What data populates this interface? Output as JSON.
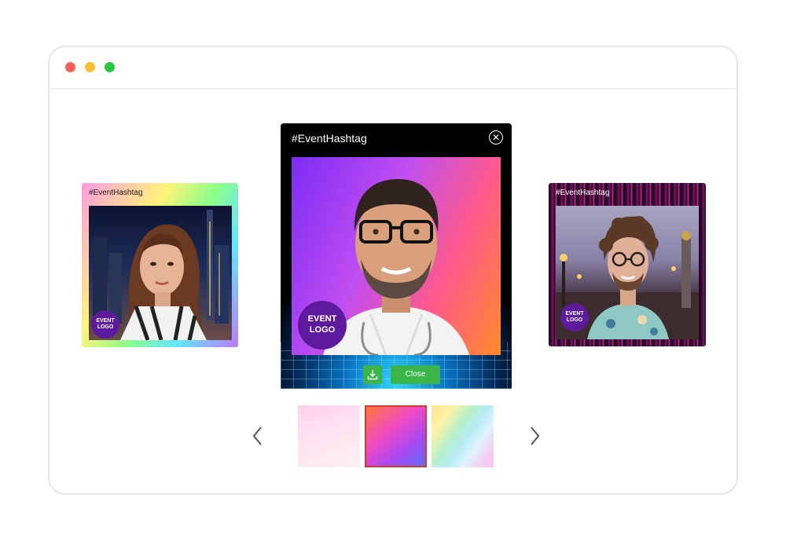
{
  "window": {
    "controls": [
      "close",
      "minimize",
      "maximize"
    ]
  },
  "left_card": {
    "hashtag": "#EventHashtag",
    "logo_line1": "EVENT",
    "logo_line2": "LOGO"
  },
  "right_card": {
    "hashtag": "#EventHashtag",
    "logo_line1": "EVENT",
    "logo_line2": "LOGO"
  },
  "modal": {
    "title": "#EventHashtag",
    "logo_line1": "EVENT",
    "logo_line2": "LOGO",
    "close_label": "Close",
    "icons": {
      "close": "close-circle-icon",
      "download": "download-icon"
    }
  },
  "thumbnails": {
    "items": [
      "pink-pastel",
      "purple-orange-gradient",
      "rainbow-pastel"
    ],
    "selected": 1,
    "icons": {
      "prev": "chevron-left-icon",
      "next": "chevron-right-icon"
    }
  },
  "colors": {
    "accent_green": "#3bb54a",
    "logo_purple": "#5e1a9c",
    "selected_border": "#d33a2f"
  }
}
